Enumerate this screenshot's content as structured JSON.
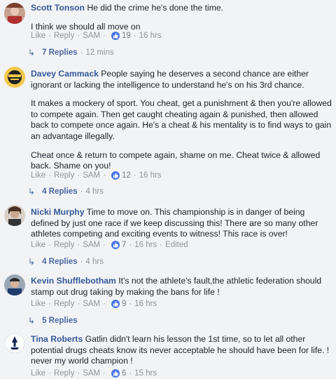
{
  "comments": [
    {
      "name": "Scott Tonson",
      "paragraphs": [
        "He did the crime he's done the time.",
        "I think we should all move on"
      ],
      "like": "Like",
      "reply": "Reply",
      "sam": "SAM",
      "count": "19",
      "time": "16 hrs",
      "replies": "7 Replies",
      "replies_time": "12 mins"
    },
    {
      "name": "Davey Cammack",
      "paragraphs": [
        "People saying he deserves a second chance are either ignorant or lacking the intelligence to understand he's on his 3rd chance.",
        "It makes a mockery of sport. You cheat, get a punishment & then you're allowed to compete again. Then get caught cheating again & punished, then allowed back to compete once again. He's a cheat & his mentality is to find ways to gain an advantage illegally.",
        "Cheat once & return to compete again, shame on me. Cheat twice & allowed back. Shame on you!"
      ],
      "like": "Like",
      "reply": "Reply",
      "sam": "SAM",
      "count": "12",
      "time": "16 hrs",
      "replies": "4 Replies",
      "replies_time": "4 hrs"
    },
    {
      "name": "Nicki Murphy",
      "paragraphs": [
        "Time to move on. This championship is in danger of being defined by just one race if we keep discussing this! There are so many other athletes competing and exciting events to witness! This race is over!"
      ],
      "like": "Like",
      "reply": "Reply",
      "sam": "SAM",
      "count": "7",
      "time": "16 hrs",
      "edited": "Edited",
      "replies": "4 Replies",
      "replies_time": "4 hrs"
    },
    {
      "name": "Kevin Shufflebotham",
      "paragraphs": [
        "It's not the athlete's fault,the athletic federation should stamp out drug taking by making the bans for life !"
      ],
      "like": "Like",
      "reply": "Reply",
      "sam": "SAM",
      "count": "9",
      "time": "16 hrs",
      "replies": "5 Replies"
    },
    {
      "name": "Tina Roberts",
      "paragraphs": [
        "Gatlin didn't learn his lesson the 1st time, so to let all other potential drugs cheats know its never acceptable he should have been for life. ! never my world champion !"
      ],
      "like": "Like",
      "reply": "Reply",
      "sam": "SAM",
      "count": "6",
      "time": "15 hrs"
    }
  ],
  "colors": {
    "name": "#365899",
    "meta": "#90949c",
    "like_badge": "#4a76e8",
    "reply_link": "#4b67a1"
  }
}
